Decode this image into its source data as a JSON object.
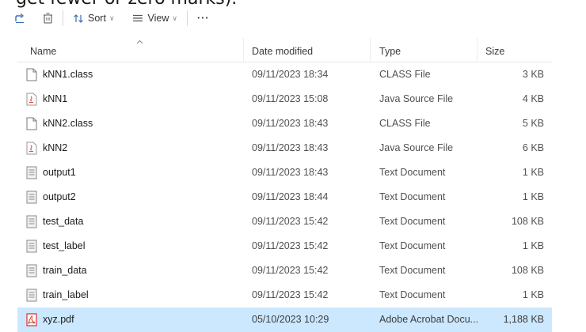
{
  "overlay_text": "get fewer or zero marks).",
  "toolbar": {
    "share_icon": "share-icon",
    "delete_icon": "trash-icon",
    "sort_label": "Sort",
    "view_label": "View",
    "more_label": "···"
  },
  "columns": {
    "name": "Name",
    "date": "Date modified",
    "type": "Type",
    "size": "Size"
  },
  "files": [
    {
      "name": "kNN1.class",
      "date": "09/11/2023 18:34",
      "type": "CLASS File",
      "size": "3 KB",
      "icon": "generic-file-icon"
    },
    {
      "name": "kNN1",
      "date": "09/11/2023 15:08",
      "type": "Java Source File",
      "size": "4 KB",
      "icon": "java-file-icon"
    },
    {
      "name": "kNN2.class",
      "date": "09/11/2023 18:43",
      "type": "CLASS File",
      "size": "5 KB",
      "icon": "generic-file-icon"
    },
    {
      "name": "kNN2",
      "date": "09/11/2023 18:43",
      "type": "Java Source File",
      "size": "6 KB",
      "icon": "java-file-icon"
    },
    {
      "name": "output1",
      "date": "09/11/2023 18:43",
      "type": "Text Document",
      "size": "1 KB",
      "icon": "text-file-icon"
    },
    {
      "name": "output2",
      "date": "09/11/2023 18:44",
      "type": "Text Document",
      "size": "1 KB",
      "icon": "text-file-icon"
    },
    {
      "name": "test_data",
      "date": "09/11/2023 15:42",
      "type": "Text Document",
      "size": "108 KB",
      "icon": "text-file-icon"
    },
    {
      "name": "test_label",
      "date": "09/11/2023 15:42",
      "type": "Text Document",
      "size": "1 KB",
      "icon": "text-file-icon"
    },
    {
      "name": "train_data",
      "date": "09/11/2023 15:42",
      "type": "Text Document",
      "size": "108 KB",
      "icon": "text-file-icon"
    },
    {
      "name": "train_label",
      "date": "09/11/2023 15:42",
      "type": "Text Document",
      "size": "1 KB",
      "icon": "text-file-icon"
    },
    {
      "name": "xyz.pdf",
      "date": "05/10/2023 10:29",
      "type": "Adobe Acrobat Docu...",
      "size": "1,188 KB",
      "icon": "pdf-file-icon",
      "selected": true
    }
  ],
  "colors": {
    "selection": "#cce8ff",
    "pdf_red": "#d9312b",
    "java_red": "#e0473b"
  }
}
